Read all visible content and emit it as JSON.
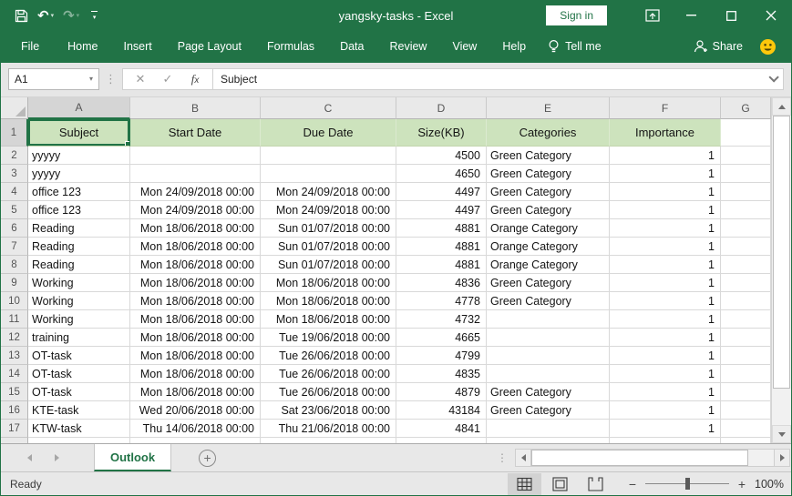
{
  "window": {
    "title": "yangsky-tasks  -  Excel",
    "sign_in_label": "Sign in"
  },
  "icons": {
    "undo": "↶",
    "redo": "↷",
    "name_box_dropdown": "▾",
    "cancel": "✕",
    "enter": "✓",
    "dots_separator": "⋮",
    "new_sheet": "+",
    "zoom_out": "−",
    "zoom_in": "+"
  },
  "ribbon": {
    "tabs": [
      "File",
      "Home",
      "Insert",
      "Page Layout",
      "Formulas",
      "Data",
      "Review",
      "View",
      "Help"
    ],
    "tell_me_label": "Tell me",
    "share_label": "Share"
  },
  "formula_bar": {
    "name_box": "A1",
    "value": "Subject"
  },
  "sheet": {
    "columns": [
      "A",
      "B",
      "C",
      "D",
      "E",
      "F",
      "G"
    ],
    "selected_cell": "A1",
    "selected_column": "A",
    "selected_row": "1",
    "header_row": {
      "number": "1",
      "cells": [
        "Subject",
        "Start Date",
        "Due Date",
        "Size(KB)",
        "Categories",
        "Importance"
      ]
    },
    "rows": [
      {
        "n": "2",
        "cells": [
          "yyyyy",
          "",
          "",
          "4500",
          "Green Category",
          "1"
        ]
      },
      {
        "n": "3",
        "cells": [
          "yyyyy",
          "",
          "",
          "4650",
          "Green Category",
          "1"
        ]
      },
      {
        "n": "4",
        "cells": [
          "office 123",
          "Mon 24/09/2018 00:00",
          "Mon 24/09/2018 00:00",
          "4497",
          "Green Category",
          "1"
        ]
      },
      {
        "n": "5",
        "cells": [
          "office 123",
          "Mon 24/09/2018 00:00",
          "Mon 24/09/2018 00:00",
          "4497",
          "Green Category",
          "1"
        ]
      },
      {
        "n": "6",
        "cells": [
          "Reading",
          "Mon 18/06/2018 00:00",
          "Sun 01/07/2018 00:00",
          "4881",
          "Orange Category",
          "1"
        ]
      },
      {
        "n": "7",
        "cells": [
          "Reading",
          "Mon 18/06/2018 00:00",
          "Sun 01/07/2018 00:00",
          "4881",
          "Orange Category",
          "1"
        ]
      },
      {
        "n": "8",
        "cells": [
          "Reading",
          "Mon 18/06/2018 00:00",
          "Sun 01/07/2018 00:00",
          "4881",
          "Orange Category",
          "1"
        ]
      },
      {
        "n": "9",
        "cells": [
          "Working",
          "Mon 18/06/2018 00:00",
          "Mon 18/06/2018 00:00",
          "4836",
          "Green Category",
          "1"
        ]
      },
      {
        "n": "10",
        "cells": [
          "Working",
          "Mon 18/06/2018 00:00",
          "Mon 18/06/2018 00:00",
          "4778",
          "Green Category",
          "1"
        ]
      },
      {
        "n": "11",
        "cells": [
          "Working",
          "Mon 18/06/2018 00:00",
          "Mon 18/06/2018 00:00",
          "4732",
          "",
          "1"
        ]
      },
      {
        "n": "12",
        "cells": [
          "training",
          "Mon 18/06/2018 00:00",
          "Tue 19/06/2018 00:00",
          "4665",
          "",
          "1"
        ]
      },
      {
        "n": "13",
        "cells": [
          "OT-task",
          "Mon 18/06/2018 00:00",
          "Tue 26/06/2018 00:00",
          "4799",
          "",
          "1"
        ]
      },
      {
        "n": "14",
        "cells": [
          "OT-task",
          "Mon 18/06/2018 00:00",
          "Tue 26/06/2018 00:00",
          "4835",
          "",
          "1"
        ]
      },
      {
        "n": "15",
        "cells": [
          "OT-task",
          "Mon 18/06/2018 00:00",
          "Tue 26/06/2018 00:00",
          "4879",
          "Green Category",
          "1"
        ]
      },
      {
        "n": "16",
        "cells": [
          "KTE-task",
          "Wed 20/06/2018 00:00",
          "Sat 23/06/2018 00:00",
          "43184",
          "Green Category",
          "1"
        ]
      },
      {
        "n": "17",
        "cells": [
          "KTW-task",
          "Thu 14/06/2018 00:00",
          "Thu 21/06/2018 00:00",
          "4841",
          "",
          "1"
        ]
      }
    ]
  },
  "sheet_tabs": {
    "active": "Outlook"
  },
  "status_bar": {
    "status": "Ready",
    "zoom": "100%"
  },
  "colors": {
    "excel_green": "#217346",
    "header_fill_green": "#cde3bd",
    "smiley_yellow": "#fdc80b"
  }
}
